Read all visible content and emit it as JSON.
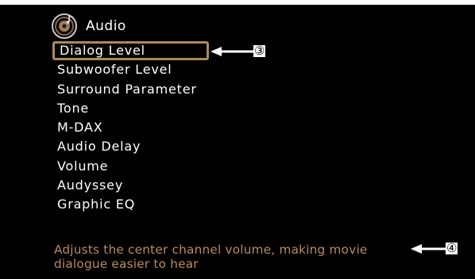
{
  "header": {
    "title": "Audio",
    "icon": "audio-disc-icon"
  },
  "menu": {
    "items": [
      {
        "label": "Dialog Level",
        "selected": true
      },
      {
        "label": "Subwoofer Level"
      },
      {
        "label": "Surround Parameter"
      },
      {
        "label": "Tone"
      },
      {
        "label": "M-DAX"
      },
      {
        "label": "Audio Delay"
      },
      {
        "label": "Volume"
      },
      {
        "label": "Audyssey"
      },
      {
        "label": "Graphic EQ"
      }
    ]
  },
  "hint": {
    "line1": "Adjusts the center channel volume, making movie",
    "line2": "dialogue easier to hear"
  },
  "callouts": {
    "menu_callout": "③",
    "hint_callout": "④"
  },
  "colors": {
    "background": "#000000",
    "selection_border": "#a88a5e",
    "hint_text": "#b98a5e"
  }
}
